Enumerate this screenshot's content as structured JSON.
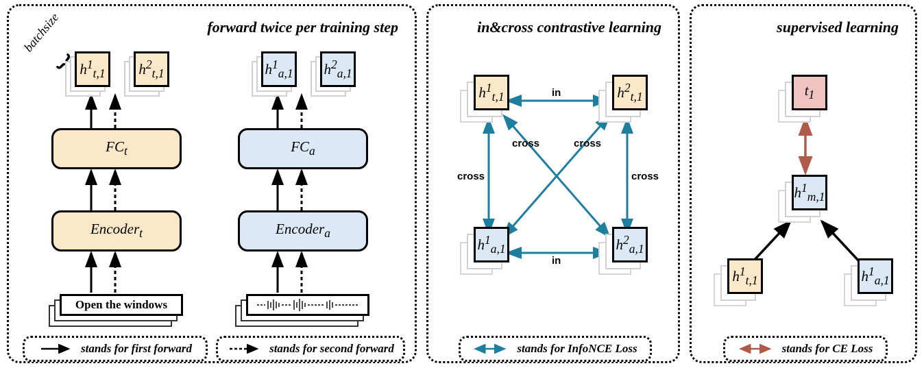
{
  "panel1": {
    "title": "forward twice per training step",
    "batchsize_label": "batchsize",
    "encoder_t": "Encoder",
    "encoder_a": "Encoder",
    "fc_t": "FC",
    "fc_a": "FC",
    "input_text": "Open the windows",
    "h_t1": "h",
    "h_t2": "h",
    "h_a1": "h",
    "h_a2": "h",
    "legend1": "stands for first forward",
    "legend2": "stands for second forward"
  },
  "panel2": {
    "title": "in&cross contrastive learning",
    "h_t1": "h",
    "h_t2": "h",
    "h_a1": "h",
    "h_a2": "h",
    "label_in": "in",
    "label_cross": "cross",
    "legend": "stands for InfoNCE Loss"
  },
  "panel3": {
    "title": "supervised learning",
    "t1": "t",
    "h_m1": "h",
    "h_t1": "h",
    "h_a1": "h",
    "legend": "stands for CE Loss"
  },
  "colors": {
    "beige": "#fbe8c9",
    "blue": "#dbe8f5",
    "red": "#f0c3bf",
    "teal": "#1e7e9e",
    "brown": "#b05a4a"
  }
}
